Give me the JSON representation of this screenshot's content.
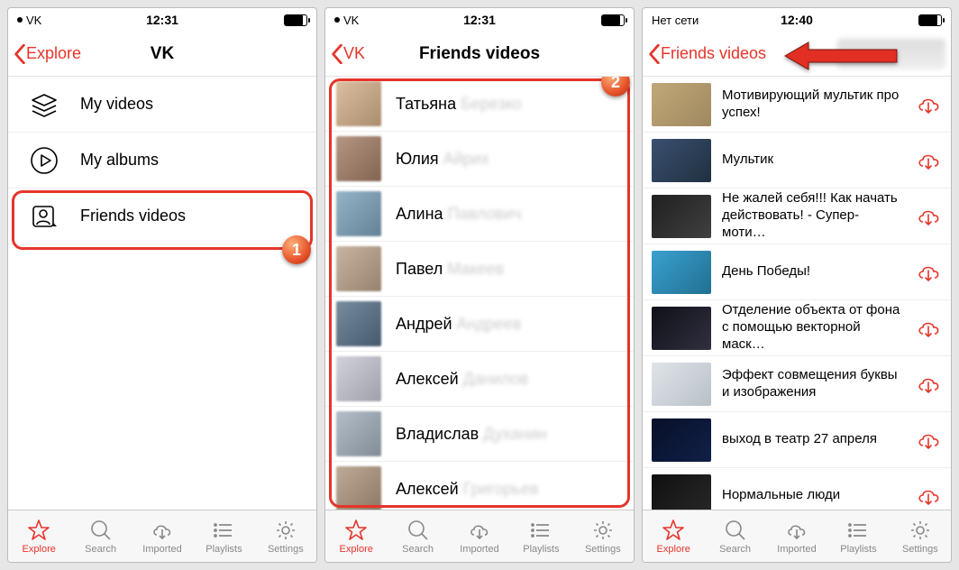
{
  "screens": [
    {
      "status": {
        "carrier": "VK",
        "time": "12:31"
      },
      "nav": {
        "back": "Explore",
        "title": "VK"
      },
      "menu": [
        {
          "label": "My videos"
        },
        {
          "label": "My albums"
        },
        {
          "label": "Friends videos"
        }
      ],
      "callout": "1"
    },
    {
      "status": {
        "carrier": "VK",
        "time": "12:31"
      },
      "nav": {
        "back": "VK",
        "title": "Friends videos"
      },
      "friends": [
        {
          "first": "Татьяна",
          "rest": "Березко"
        },
        {
          "first": "Юлия",
          "rest": "Айрих"
        },
        {
          "first": "Алина",
          "rest": "Павлович"
        },
        {
          "first": "Павел",
          "rest": "Макеев"
        },
        {
          "first": "Андрей",
          "rest": "Андреев"
        },
        {
          "first": "Алексей",
          "rest": "Данилов"
        },
        {
          "first": "Владислав",
          "rest": "Духанин"
        },
        {
          "first": "Алексей",
          "rest": "Григорьев"
        }
      ],
      "callout": "2"
    },
    {
      "status": {
        "carrier": "Нет сети",
        "time": "12:40"
      },
      "nav": {
        "back": "Friends videos",
        "title": ""
      },
      "videos": [
        {
          "title": "Мотивирующий мультик про успех!"
        },
        {
          "title": "Мультик"
        },
        {
          "title": "Не жалей себя!!! Как начать действовать! - Супер-моти…"
        },
        {
          "title": "День Победы!"
        },
        {
          "title": "Отделение объекта от фона с помощью векторной маск…"
        },
        {
          "title": "Эффект совмещения буквы и изображения"
        },
        {
          "title": "выход в театр 27 апреля"
        },
        {
          "title": "Нормальные люди"
        }
      ]
    }
  ],
  "tabs": [
    {
      "label": "Explore",
      "active": true
    },
    {
      "label": "Search",
      "active": false
    },
    {
      "label": "Imported",
      "active": false
    },
    {
      "label": "Playlists",
      "active": false
    },
    {
      "label": "Settings",
      "active": false
    }
  ]
}
